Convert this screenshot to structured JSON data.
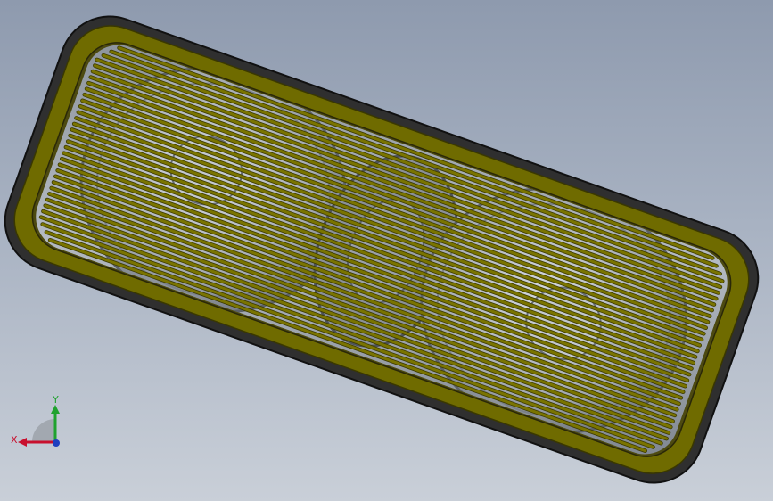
{
  "model": {
    "name": "",
    "colors": {
      "background_top": "#8e9aae",
      "background_bottom": "#c9cfd8",
      "frame_edge": "#2b2b2b",
      "frame_face": "#6e6a00",
      "grille_bar": "#7a7400",
      "cavity": "#9aa0a8",
      "speaker_ring": "#b9bec5"
    },
    "grille_bar_count": 34
  },
  "triad": {
    "x_label": "X",
    "y_label": "Y",
    "x_color": "#c8102e",
    "y_color": "#1fa22e",
    "z_color": "#1e3fbf"
  }
}
